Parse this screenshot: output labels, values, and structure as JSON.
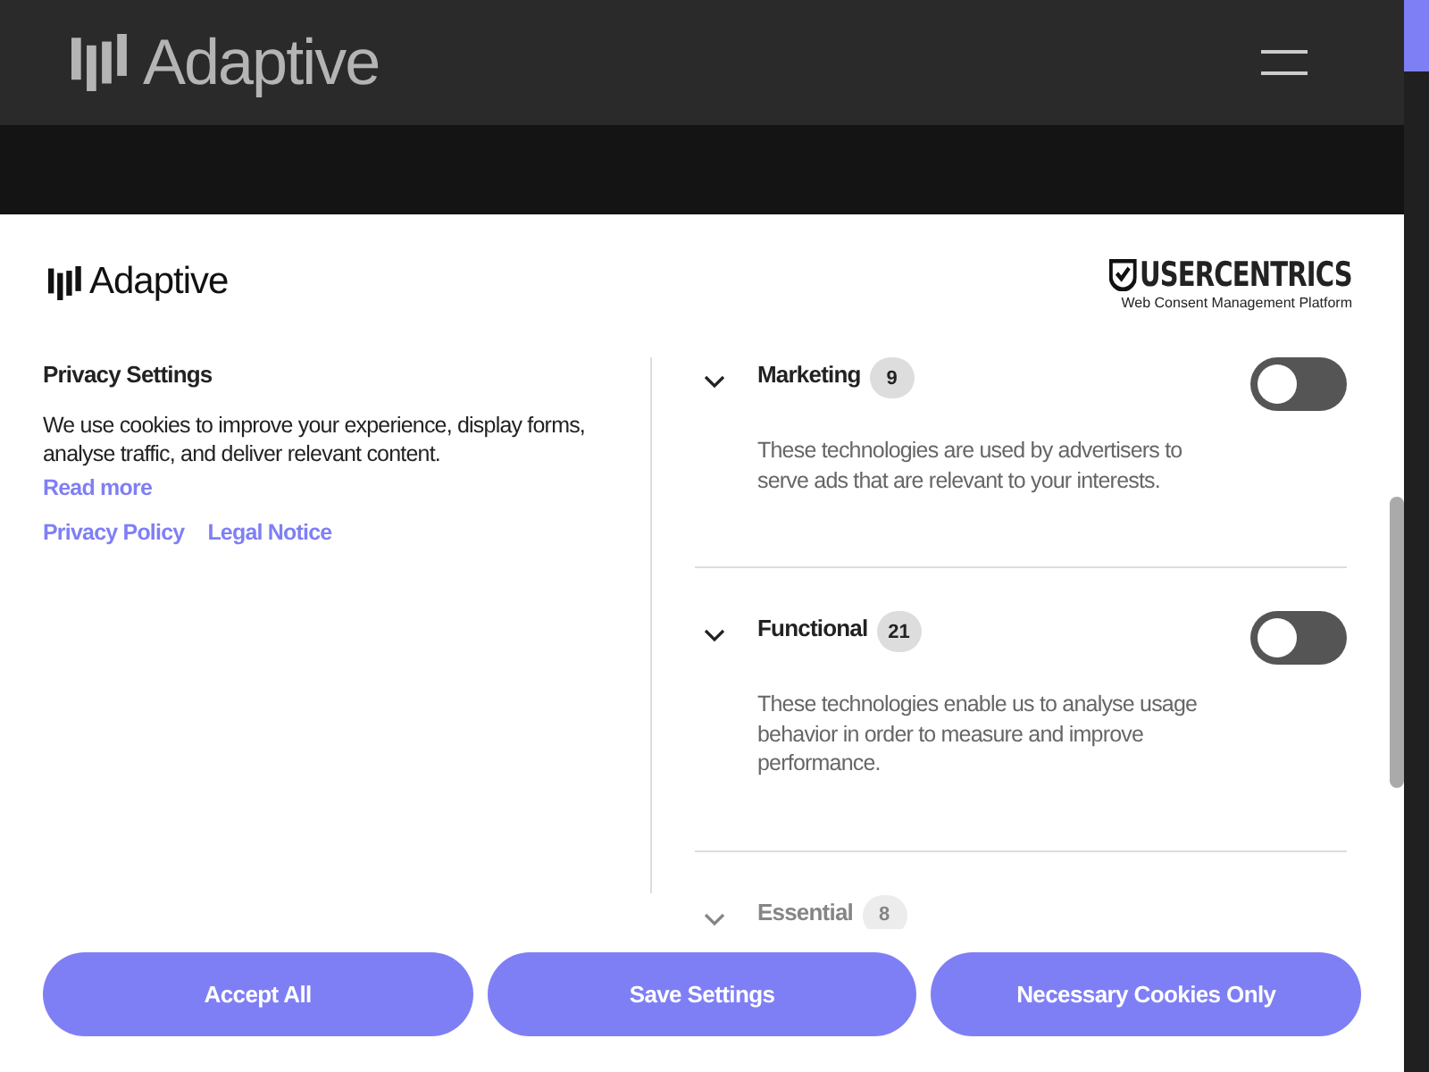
{
  "site_header": {
    "logo": "Adaptive"
  },
  "consent_dialog": {
    "logo": "Adaptive",
    "provider": {
      "name": "USERCENTRICS",
      "tagline": "Web Consent Management Platform"
    },
    "title": "Privacy Settings",
    "description": "We use cookies to improve your experience, display forms, analyse traffic, and deliver relevant content.",
    "read_more": "Read more",
    "links": [
      "Privacy Policy",
      "Legal Notice"
    ],
    "categories": [
      {
        "name": "Marketing",
        "count": "9",
        "description": "These technologies are used by advertisers to serve ads that are relevant to your interests.",
        "on": false,
        "expanded": false
      },
      {
        "name": "Functional",
        "count": "21",
        "description": "These technologies enable us to analyse usage behavior in order to measure and improve performance.",
        "on": false,
        "expanded": false
      },
      {
        "name": "Essential",
        "count": "8",
        "expanded": false
      }
    ],
    "buttons": [
      "Accept All",
      "Save Settings",
      "Necessary Cookies Only"
    ]
  }
}
